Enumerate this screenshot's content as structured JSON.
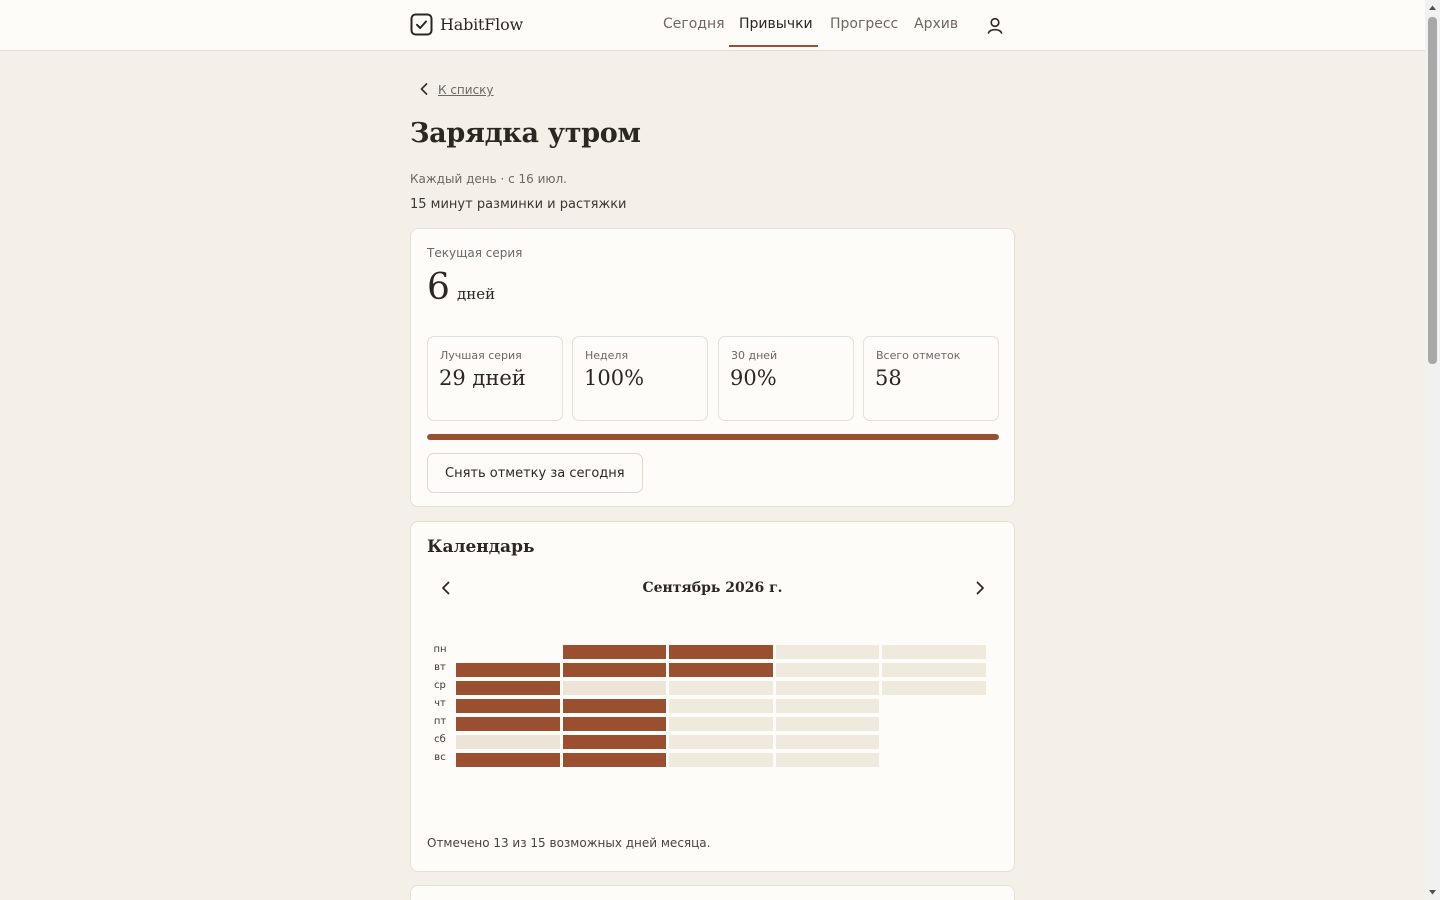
{
  "app": {
    "name": "HabitFlow"
  },
  "nav": {
    "items": [
      {
        "label": "Сегодня",
        "active": false
      },
      {
        "label": "Привычки",
        "active": true
      },
      {
        "label": "Прогресс",
        "active": false
      },
      {
        "label": "Архив",
        "active": false
      }
    ],
    "user_icon": "user-icon"
  },
  "back_link": {
    "label": "К списку",
    "icon": "chevron-left-icon"
  },
  "habit": {
    "title": "Зарядка утром",
    "schedule": "Каждый день · с 16 июл.",
    "description": "15 минут разминки и растяжки"
  },
  "streak": {
    "label": "Текущая серия",
    "value": "6",
    "unit": "дней"
  },
  "stats": [
    {
      "label": "Лучшая серия",
      "value": "29 дней"
    },
    {
      "label": "Неделя",
      "value": "100%"
    },
    {
      "label": "30 дней",
      "value": "90%"
    },
    {
      "label": "Всего отметок",
      "value": "58"
    }
  ],
  "progress": {
    "fraction": 1.0
  },
  "actions": {
    "uncheck_label": "Снять отметку за сегодня"
  },
  "calendar": {
    "title": "Календарь",
    "month": "Сентябрь 2026 г.",
    "prev_icon": "chevron-left-icon",
    "next_icon": "chevron-right-icon",
    "weekdays": [
      "пн",
      "вт",
      "ср",
      "чт",
      "пт",
      "сб",
      "вс"
    ],
    "weeks": [
      [
        null,
        "done",
        "done",
        "done",
        "done",
        "missed",
        "done"
      ],
      [
        "done",
        "done",
        "missed",
        "done",
        "done",
        "done",
        "done"
      ],
      [
        "done",
        "done",
        "future",
        "future",
        "future",
        "future",
        "future"
      ],
      [
        "future",
        "future",
        "future",
        "future",
        "future",
        "future",
        "future"
      ],
      [
        "future",
        "future",
        "future",
        null,
        null,
        null,
        null
      ]
    ],
    "footer": "Отмечено 13 из 15 возможных дней месяца.",
    "colors": {
      "done": "#9a4f30",
      "missed": "#ece4d6",
      "future": "#f0e9dd"
    }
  }
}
